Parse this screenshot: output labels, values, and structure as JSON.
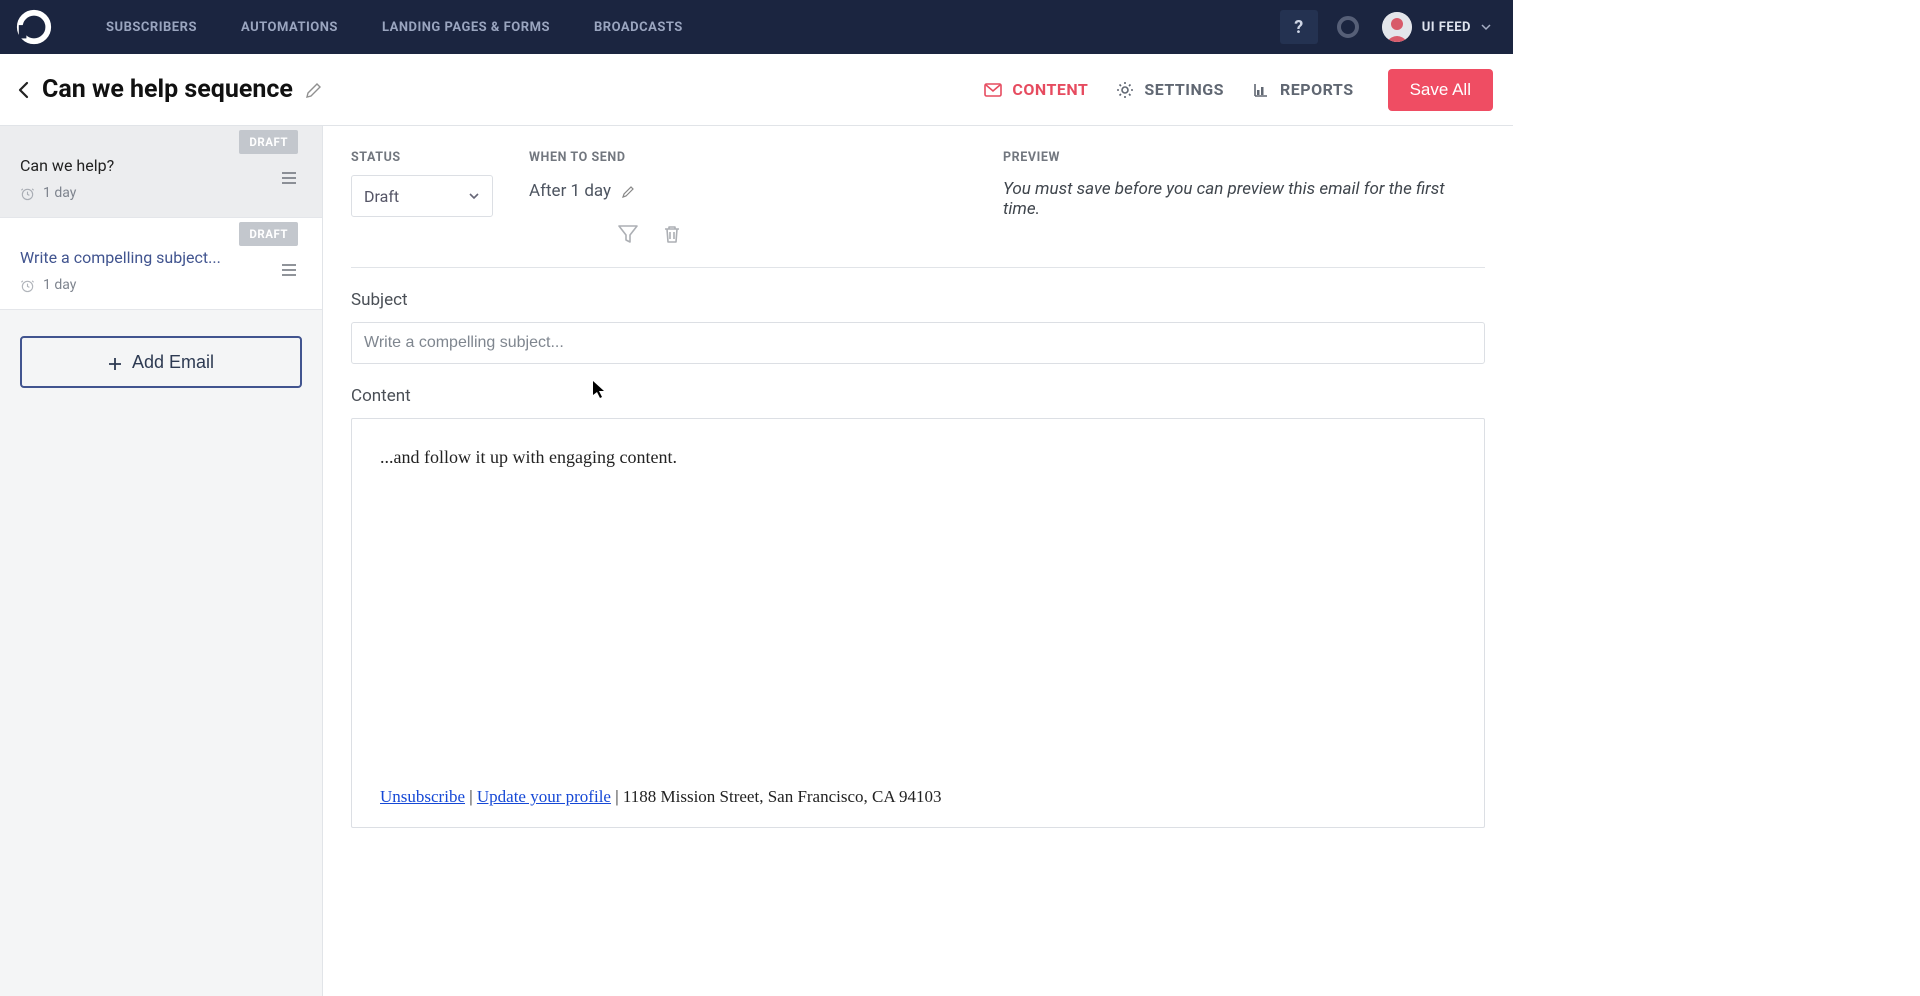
{
  "nav": {
    "items": [
      "SUBSCRIBERS",
      "AUTOMATIONS",
      "LANDING PAGES & FORMS",
      "BROADCASTS"
    ],
    "help_label": "?",
    "user_label": "UI FEED"
  },
  "header": {
    "title": "Can we help sequence",
    "tabs": {
      "content": "CONTENT",
      "settings": "SETTINGS",
      "reports": "REPORTS"
    },
    "save_all": "Save All"
  },
  "sidebar": {
    "emails": [
      {
        "title": "Can we help?",
        "badge": "DRAFT",
        "delay": "1 day"
      },
      {
        "title": "Write a compelling subject...",
        "badge": "DRAFT",
        "delay": "1 day"
      }
    ],
    "add_btn": "Add Email"
  },
  "editor": {
    "status_label": "STATUS",
    "status_value": "Draft",
    "when_label": "WHEN TO SEND",
    "when_value": "After 1 day",
    "preview_label": "PREVIEW",
    "preview_text": "You must save before you can preview this email for the first time.",
    "subject_label": "Subject",
    "subject_placeholder": "Write a compelling subject...",
    "content_label": "Content",
    "content_body": "...and follow it up with engaging content.",
    "footer": {
      "unsubscribe": "Unsubscribe",
      "update_profile": "Update your profile",
      "address": "1188 Mission Street, San Francisco, CA 94103",
      "sep": " | "
    }
  }
}
